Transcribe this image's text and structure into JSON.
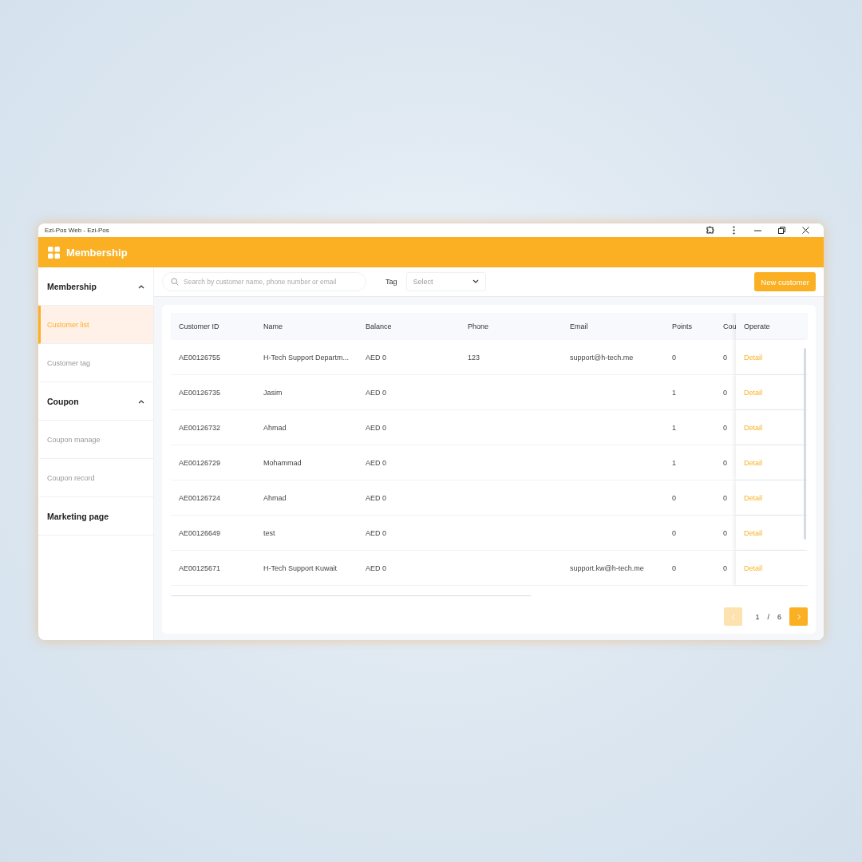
{
  "window": {
    "title": "Ezi-Pos Web - Ezi-Pos"
  },
  "header": {
    "title": "Membership"
  },
  "sidebar": {
    "groups": [
      {
        "label": "Membership",
        "expanded": true,
        "items": [
          {
            "label": "Customer list",
            "selected": true
          },
          {
            "label": "Customer tag",
            "selected": false
          }
        ]
      },
      {
        "label": "Coupon",
        "expanded": true,
        "items": [
          {
            "label": "Coupon manage",
            "selected": false
          },
          {
            "label": "Coupon record",
            "selected": false
          }
        ]
      },
      {
        "label": "Marketing page"
      }
    ]
  },
  "toolbar": {
    "search": {
      "placeholder": "Search by customer name, phone number or email"
    },
    "tag_label": "Tag",
    "tag_select": {
      "placeholder": "Select"
    },
    "new_button": "New customer"
  },
  "table": {
    "columns": [
      "Customer ID",
      "Name",
      "Balance",
      "Phone",
      "Email",
      "Points",
      "Cou",
      "Operate"
    ],
    "rows": [
      {
        "cells": [
          "AE00126755",
          "H-Tech Support Departm...",
          "AED 0",
          "123",
          "support@h-tech.me",
          "0",
          "0"
        ],
        "action": "Detail"
      },
      {
        "cells": [
          "AE00126735",
          "Jasim",
          "AED 0",
          "",
          "",
          "1",
          "0"
        ],
        "action": "Detail"
      },
      {
        "cells": [
          "AE00126732",
          "Ahmad",
          "AED 0",
          "",
          "",
          "1",
          "0"
        ],
        "action": "Detail"
      },
      {
        "cells": [
          "AE00126729",
          "Mohammad",
          "AED 0",
          "",
          "",
          "1",
          "0"
        ],
        "action": "Detail"
      },
      {
        "cells": [
          "AE00126724",
          "Ahmad",
          "AED 0",
          "",
          "",
          "0",
          "0"
        ],
        "action": "Detail"
      },
      {
        "cells": [
          "AE00126649",
          "test",
          "AED 0",
          "",
          "",
          "0",
          "0"
        ],
        "action": "Detail"
      },
      {
        "cells": [
          "AE00125671",
          "H-Tech Support Kuwait",
          "AED 0",
          "",
          "support.kw@h-tech.me",
          "0",
          "0"
        ],
        "action": "Detail"
      }
    ]
  },
  "pagination": {
    "prev_disabled": true,
    "next_disabled": false,
    "current": "1",
    "separator": "/",
    "total": "6"
  }
}
